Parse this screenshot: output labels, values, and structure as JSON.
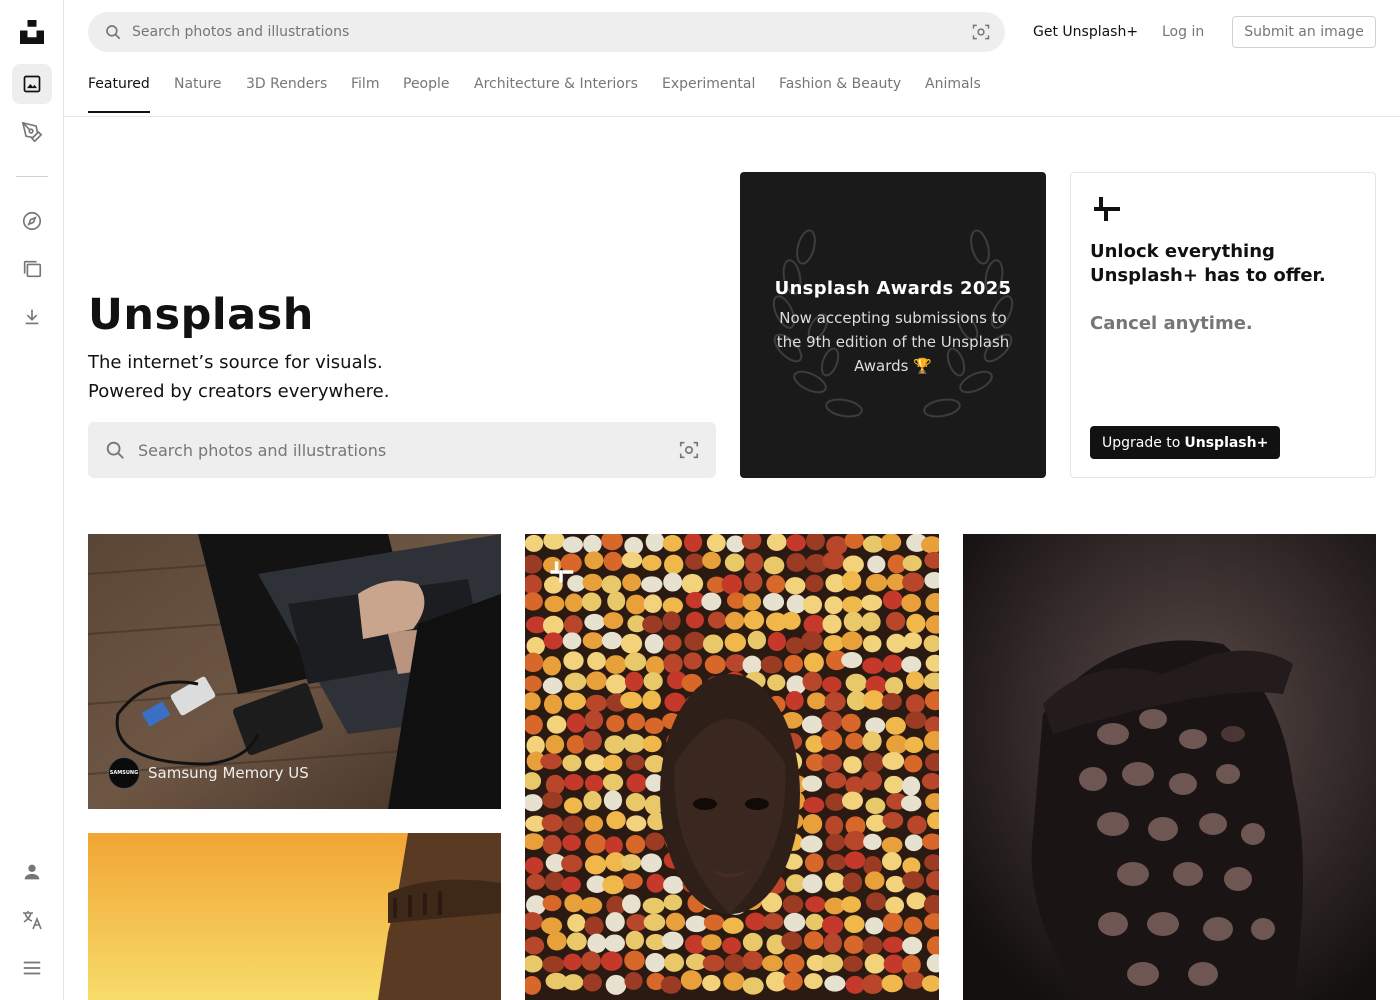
{
  "header": {
    "search_placeholder": "Search photos and illustrations",
    "get_plus": "Get Unsplash+",
    "login": "Log in",
    "submit": "Submit an image"
  },
  "tabs": [
    {
      "label": "Featured",
      "active": true
    },
    {
      "label": "Nature"
    },
    {
      "label": "3D Renders"
    },
    {
      "label": "Film"
    },
    {
      "label": "People"
    },
    {
      "label": "Architecture & Interiors"
    },
    {
      "label": "Experimental"
    },
    {
      "label": "Fashion & Beauty"
    },
    {
      "label": "Animals"
    }
  ],
  "rail": {
    "icons": [
      "unsplash-logo-icon",
      "image-icon",
      "pen-nib-icon",
      "compass-icon",
      "collections-icon",
      "download-icon",
      "user-icon",
      "translate-icon",
      "menu-icon"
    ]
  },
  "hero": {
    "title": "Unsplash",
    "subtitle_line1": "The internet’s source for visuals.",
    "subtitle_line2": "Powered by creators everywhere.",
    "search_placeholder": "Search photos and illustrations"
  },
  "awards": {
    "title": "Unsplash Awards 2025",
    "body": "Now accepting submissions to the 9th edition of the Unsplash Awards 🏆"
  },
  "plus_card": {
    "headline": "Unlock everything Unsplash+ has to offer.",
    "cancel": "Cancel anytime.",
    "button_prefix": "Upgrade to",
    "button_brand": "Unsplash+"
  },
  "photos": [
    {
      "credit": "Samsung Memory US",
      "avatar_text": "SAMSUNG"
    },
    {},
    {},
    {}
  ]
}
